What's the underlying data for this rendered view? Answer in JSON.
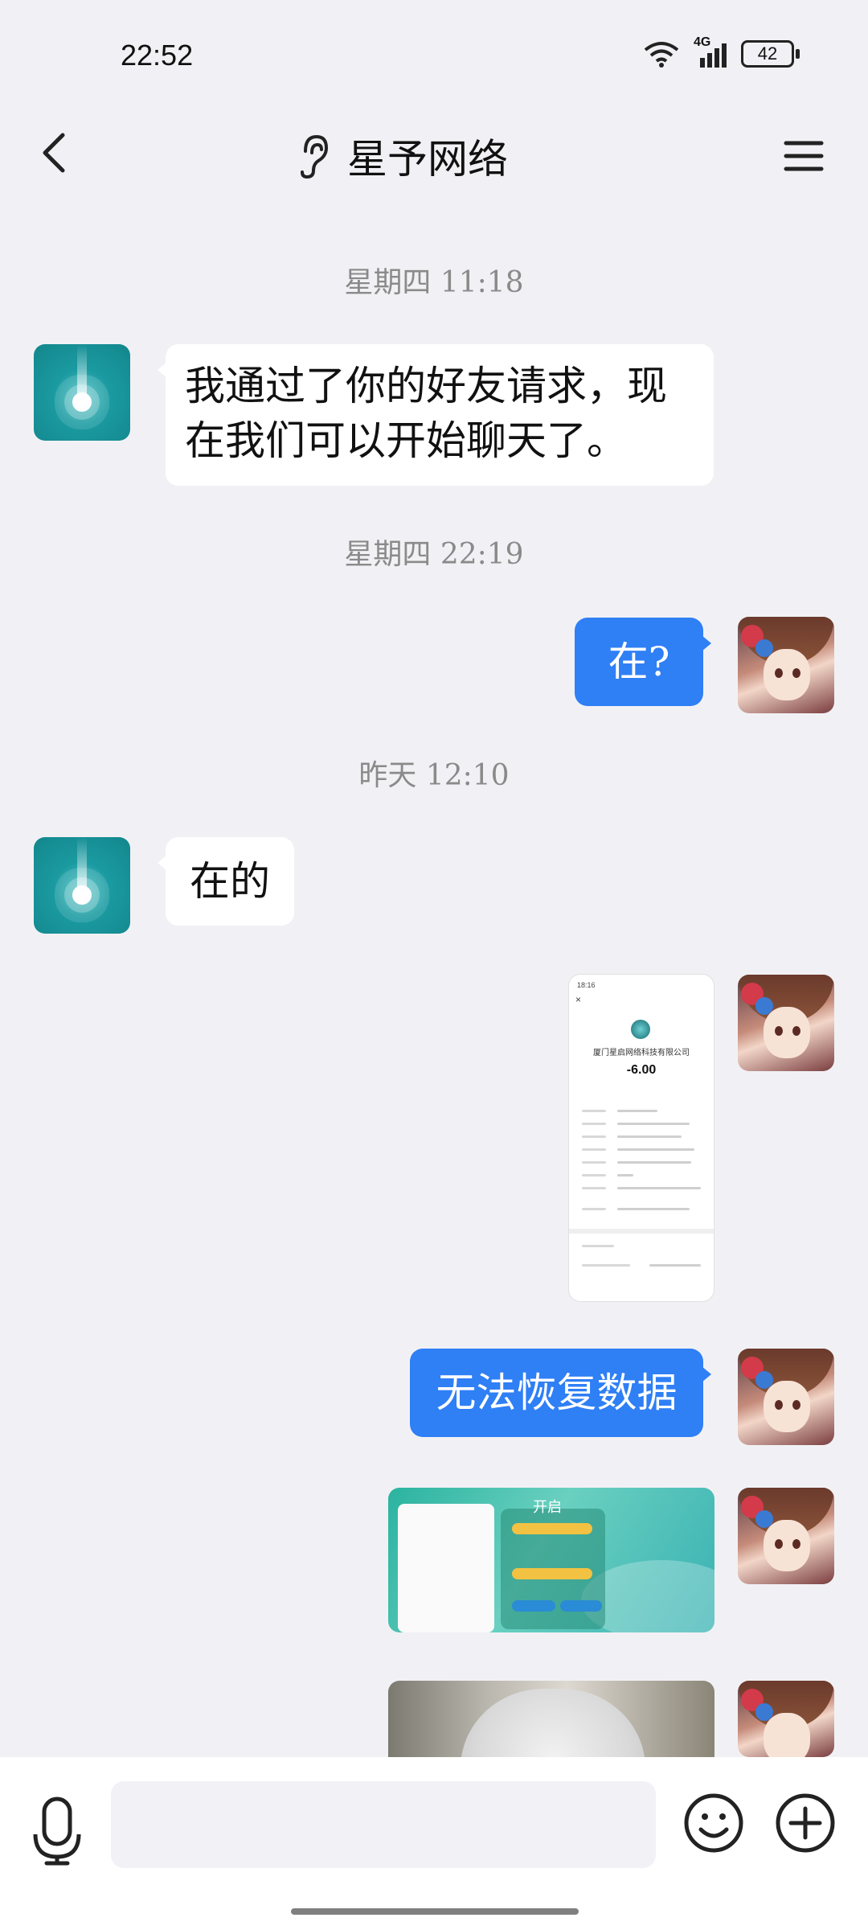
{
  "status_bar": {
    "time": "22:52",
    "network": "4G",
    "battery": "42",
    "icons": [
      "wifi-icon",
      "signal-icon",
      "battery-icon"
    ]
  },
  "header": {
    "title": "星予网络",
    "icons": [
      "back-icon",
      "ear-icon",
      "menu-icon"
    ]
  },
  "messages": [
    {
      "type": "timestamp",
      "text": "星期四 11:18"
    },
    {
      "type": "text",
      "side": "in",
      "text_lines": [
        "我通过了你的好友请求，现",
        "在我们可以开始聊天了。"
      ]
    },
    {
      "type": "timestamp",
      "text": "星期四 22:19"
    },
    {
      "type": "text",
      "side": "out",
      "text": "在?"
    },
    {
      "type": "timestamp",
      "text": "昨天 12:10"
    },
    {
      "type": "text",
      "side": "in",
      "text": "在的"
    },
    {
      "type": "image",
      "side": "out",
      "kind": "payment-receipt-screenshot",
      "name": "厦门星启网络科技有限公司",
      "amount": "-6.00"
    },
    {
      "type": "text",
      "side": "out",
      "text": "无法恢复数据"
    },
    {
      "type": "image",
      "side": "out",
      "kind": "game-screenshot",
      "caption": "开启"
    },
    {
      "type": "image",
      "side": "out",
      "kind": "photo"
    }
  ],
  "input": {
    "placeholder": "",
    "icons": [
      "microphone-icon",
      "emoji-icon",
      "plus-icon"
    ]
  },
  "colors": {
    "background": "#f1f1f5",
    "outgoing_bubble": "#2f7ff5",
    "incoming_bubble": "#ffffff",
    "timestamp": "#8a8a8a"
  }
}
